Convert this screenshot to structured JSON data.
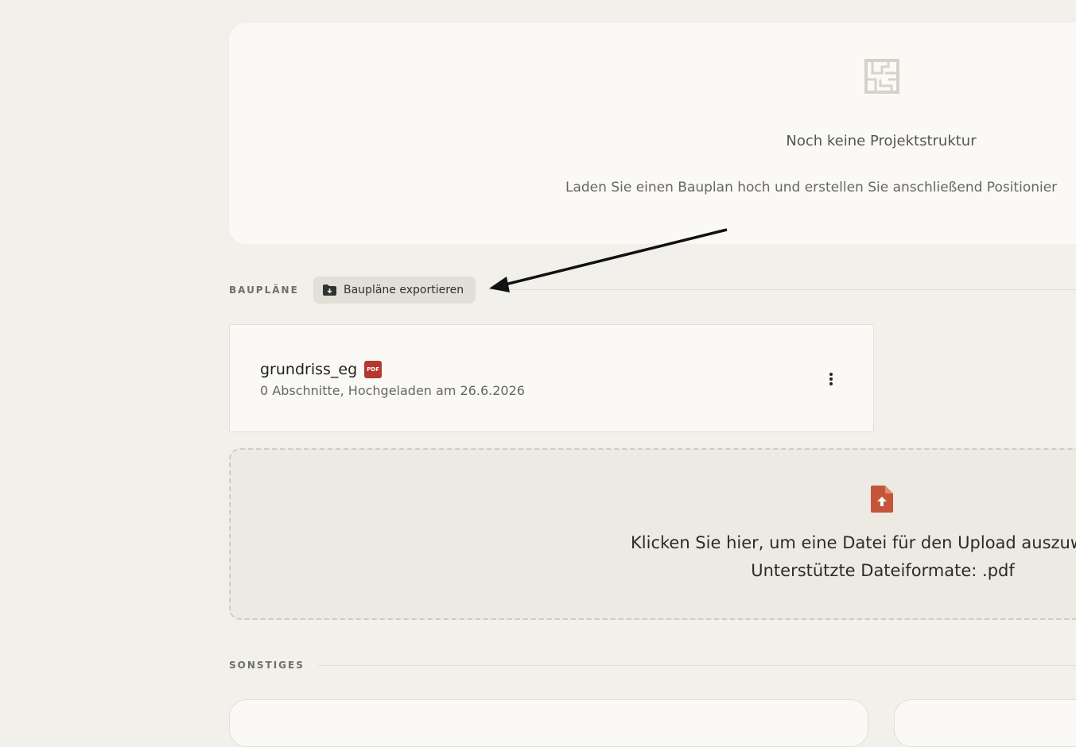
{
  "empty_state": {
    "icon": "floorplan-icon",
    "title": "Noch keine Projektstruktur",
    "description": "Laden Sie einen Bauplan hoch und erstellen Sie anschließend Positionier"
  },
  "plans_section": {
    "label": "BAUPLÄNE",
    "export_button": {
      "label": "Baupläne exportieren",
      "icon": "folder-download-icon"
    }
  },
  "file": {
    "name": "grundriss_eg",
    "badge": "PDF",
    "meta": "0 Abschnitte, Hochgeladen am 26.6.2026",
    "menu_icon": "kebab-menu-icon"
  },
  "upload": {
    "icon": "file-upload-icon",
    "text": "Klicken Sie hier, um eine Datei für den Upload auszuw",
    "formats": "Unterstützte Dateiformate: .pdf"
  },
  "other_section": {
    "label": "SONSTIGES"
  },
  "colors": {
    "background": "#f2f0ea",
    "card": "#faf9f5",
    "accent": "#c4543a",
    "pdf_badge": "#b4382f"
  }
}
